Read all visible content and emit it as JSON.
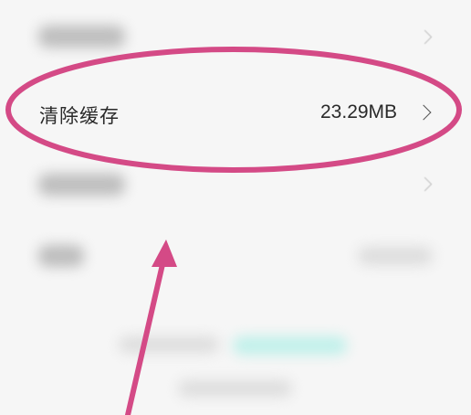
{
  "settings": {
    "clear_cache": {
      "label": "清除缓存",
      "value": "23.29MB"
    }
  },
  "colors": {
    "annotation": "#d44a86",
    "text": "#2a2a2a",
    "background": "#f6f6f6"
  },
  "icons": {
    "row_chevron": "chevron-right-icon"
  }
}
